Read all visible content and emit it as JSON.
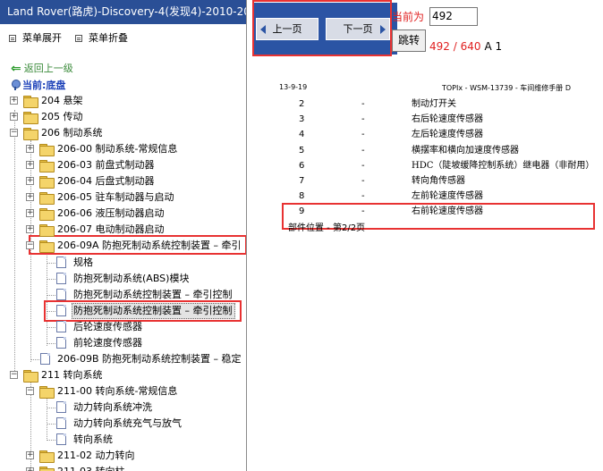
{
  "title": "Land Rover(路虎)-Discovery-4(发现4)-2010-20",
  "menu": {
    "expand": "菜单展开",
    "collapse": "菜单折叠"
  },
  "back": "返回上一级",
  "current": "当前:底盘",
  "tree": [
    {
      "label": "204 悬架"
    },
    {
      "label": "205 传动"
    },
    {
      "label": "206 制动系统"
    },
    {
      "label": "206-00 制动系统-常规信息"
    },
    {
      "label": "206-03 前盘式制动器"
    },
    {
      "label": "206-04 后盘式制动器"
    },
    {
      "label": "206-05 驻车制动器与启动"
    },
    {
      "label": "206-06 液压制动器启动"
    },
    {
      "label": "206-07 电动制动器启动"
    },
    {
      "label": "206-09A 防抱死制动系统控制装置 – 牵引"
    },
    {
      "label": "规格"
    },
    {
      "label": "防抱死制动系统(ABS)模块"
    },
    {
      "label": "防抱死制动系统控制装置 – 牵引控制"
    },
    {
      "label": "防抱死制动系统控制装置 – 牵引控制"
    },
    {
      "label": "后轮速度传感器"
    },
    {
      "label": "前轮速度传感器"
    },
    {
      "label": "206-09B 防抱死制动系统控制装置 – 稳定"
    },
    {
      "label": "211 转向系统"
    },
    {
      "label": "211-00 转向系统-常规信息"
    },
    {
      "label": "动力转向系统冲洗"
    },
    {
      "label": "动力转向系统充气与放气"
    },
    {
      "label": "转向系统"
    },
    {
      "label": "211-02 动力转向"
    },
    {
      "label": "211-03 转向柱"
    }
  ],
  "toolbar": {
    "prev": "上一页",
    "next": "下一页",
    "current_label": "当前为",
    "page_value": "492",
    "go": "跳转",
    "page_count": "492 / 640",
    "a1": "A 1"
  },
  "doc": {
    "header_date": "13-9-19",
    "header_title": "TOPIx - WSM-13739 - 车间维修手册 D",
    "rows": [
      {
        "n": "2",
        "d": "-",
        "t": "制动灯开关"
      },
      {
        "n": "3",
        "d": "-",
        "t": "右后轮速度传感器"
      },
      {
        "n": "4",
        "d": "-",
        "t": "左后轮速度传感器"
      },
      {
        "n": "5",
        "d": "-",
        "t": "横摆率和横向加速度传感器"
      },
      {
        "n": "6",
        "d": "-",
        "t": "HDC（陡坡缓降控制系统）继电器（非耐用）"
      },
      {
        "n": "7",
        "d": "-",
        "t": "转向角传感器"
      },
      {
        "n": "8",
        "d": "-",
        "t": "左前轮速度传感器"
      },
      {
        "n": "9",
        "d": "-",
        "t": "右前轮速度传感器"
      }
    ],
    "footer": "部件位置 - 第2/2页"
  }
}
